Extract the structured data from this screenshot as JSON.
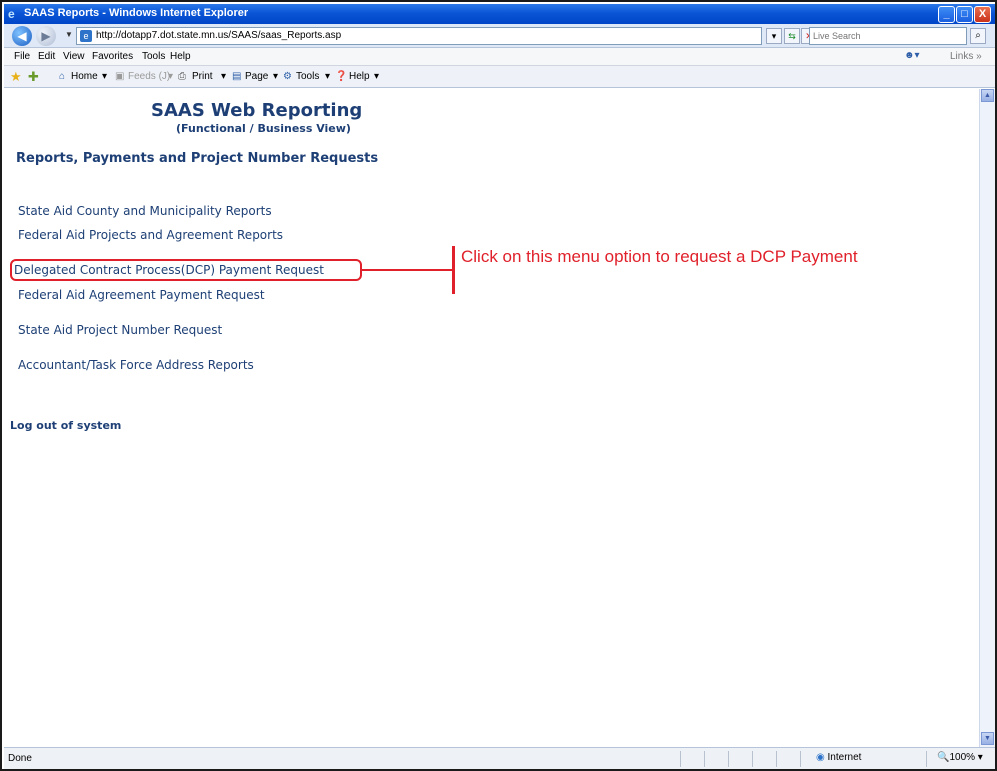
{
  "window": {
    "title": "SAAS Reports - Windows Internet Explorer",
    "minimize_glyph": "_",
    "maximize_glyph": "□",
    "close_glyph": "X"
  },
  "address_bar": {
    "url": "http://dotapp7.dot.state.mn.us/SAAS/saas_Reports.asp",
    "search_placeholder": "Live Search"
  },
  "menu_bar": {
    "items": [
      "File",
      "Edit",
      "View",
      "Favorites",
      "Tools",
      "Help"
    ],
    "links_label": "Links »"
  },
  "command_bar": {
    "home": "Home",
    "feeds": "Feeds (J)",
    "print": "Print",
    "page": "Page",
    "tools": "Tools",
    "help": "Help"
  },
  "page": {
    "title": "SAAS Web Reporting",
    "subtitle": "(Functional / Business View)",
    "section_title": "Reports, Payments and Project Number Requests",
    "menu_links": [
      "State Aid County and Municipality Reports",
      "Federal Aid Projects and Agreement Reports",
      "Delegated Contract Process(DCP) Payment Request",
      "Federal Aid Agreement Payment Request",
      "State Aid Project Number Request",
      "Accountant/Task Force Address Reports"
    ],
    "logout": "Log out of system"
  },
  "annotation": {
    "text": "Click on this menu option to request a DCP Payment",
    "color": "#e0202a"
  },
  "status_bar": {
    "status": "Done",
    "zone": "Internet",
    "zoom": "100%"
  },
  "colors": {
    "link": "#1d3f75",
    "titlebar": "#0a55d6"
  }
}
